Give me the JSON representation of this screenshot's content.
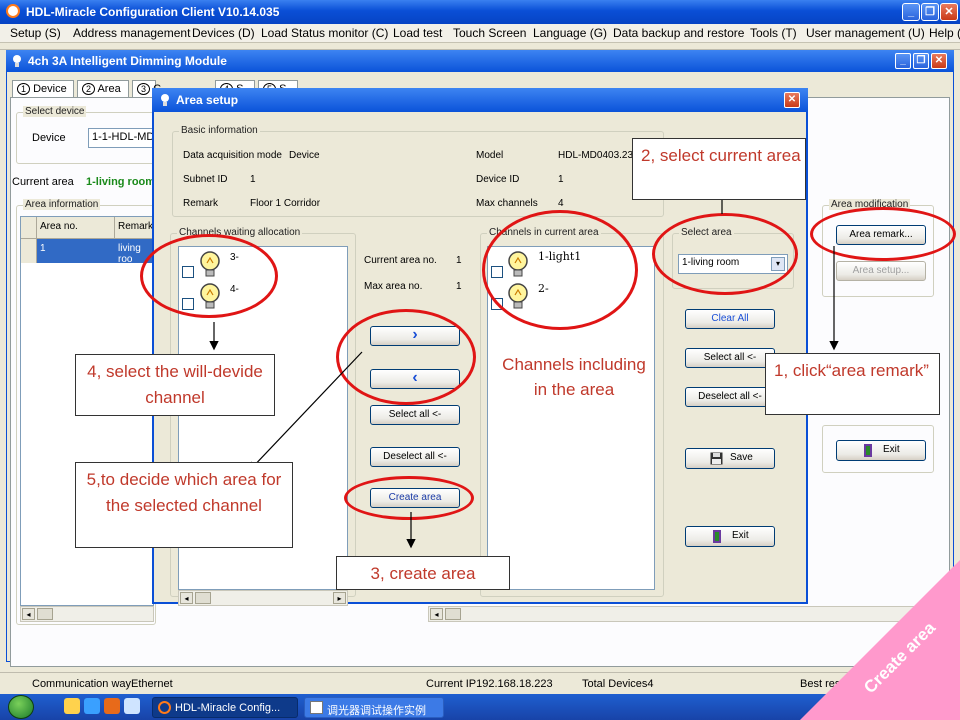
{
  "app": {
    "title": "HDL-Miracle Configuration Client V10.14.035",
    "controls": {
      "minimize": "_",
      "restore": "❐",
      "close": "✕"
    }
  },
  "menu": [
    "Setup (S)",
    "Address management",
    "Devices (D)",
    "Load Status monitor (C)",
    "Load test",
    "Touch Screen",
    "Language (G)",
    "Data backup and restore",
    "Tools (T)",
    "User management (U)",
    "Help ("
  ],
  "module": {
    "title": "4ch 3A Intelligent Dimming Module",
    "tabs": [
      "Device",
      "Area",
      "C",
      "S",
      "S"
    ],
    "tab_numbers": [
      "1",
      "2",
      "3",
      "4",
      "5"
    ],
    "select_device_label": "Select device",
    "device_label": "Device",
    "device_value": "1-1-HDL-MD0",
    "current_area_label": "Current area",
    "current_area_value": "1-living room",
    "area_info_label": "Area information",
    "table": {
      "headers": [
        "Area no.",
        "Remark"
      ],
      "rows": [
        [
          "1",
          "living roo"
        ]
      ]
    },
    "area_modification_label": "Area modification",
    "area_remark_button": "Area remark...",
    "area_setup_button": "Area setup...",
    "exit_button": "Exit"
  },
  "dialog": {
    "title": "Area setup",
    "close": "✕",
    "basic_info_label": "Basic information",
    "fields": {
      "data_mode_label": "Data acquisition mode",
      "data_mode_value": "Device",
      "subnet_label": "Subnet ID",
      "subnet_value": "1",
      "remark_label": "Remark",
      "remark_value": "Floor 1 Corridor",
      "model_label": "Model",
      "model_value": "HDL-MD0403.23",
      "device_id_label": "Device ID",
      "device_id_value": "1",
      "max_channels_label": "Max channels",
      "max_channels_value": "4"
    },
    "waiting_label": "Channels waiting allocation",
    "waiting_channels": [
      "3-",
      "4-"
    ],
    "current_area_no_label": "Current area no.",
    "current_area_no_value": "1",
    "max_area_no_label": "Max area no.",
    "max_area_no_value": "1",
    "move_right": "›",
    "move_left": "‹",
    "select_all_button": "Select all <-",
    "deselect_all_button": "Deselect all <-",
    "create_area_button": "Create area",
    "in_area_label": "Channels in current area",
    "in_area_channels": [
      "1-light1",
      "2-"
    ],
    "select_area_label": "Select area",
    "select_area_value": "1-living room",
    "clear_all_button": "Clear All",
    "select_all_right_button": "Select all <-",
    "deselect_all_right_button": "Deselect all <-",
    "save_button": "Save",
    "exit_button": "Exit"
  },
  "status": {
    "comm_way": "Communication wayEthernet",
    "current_ip": "Current IP192.168.18.223",
    "total_devices": "Total Devices4",
    "best": "Best resol"
  },
  "taskbar": {
    "items": [
      "HDL-Miracle Config...",
      "调光器调试操作实例"
    ]
  },
  "annotations": {
    "a1": "1, click“area remark”",
    "a2": "2, select current area",
    "a3": "3, create area",
    "a4": "4, select the will-devide channel",
    "a5": "5,to decide which area for the selected channel",
    "channels_note": "Channels including in the area",
    "corner": "Create area"
  },
  "colors": {
    "title_blue": "#0a4fd6",
    "annotation_red": "#c0392b",
    "ring_red": "#e01515",
    "corner_pink": "#ff99cc"
  }
}
